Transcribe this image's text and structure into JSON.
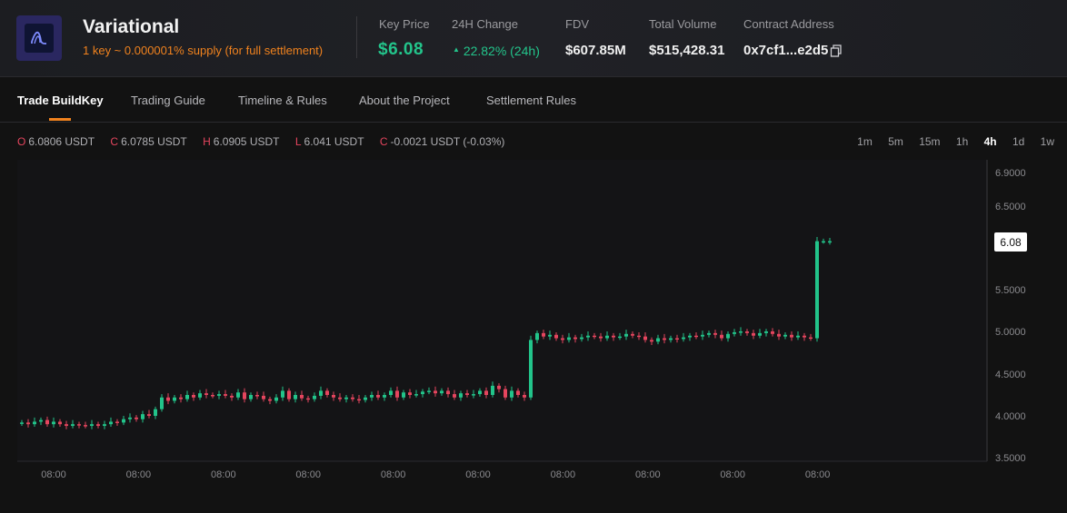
{
  "header": {
    "title": "Variational",
    "subtitle": "1 key ~ 0.000001% supply (for full settlement)",
    "stats": {
      "key_price_label": "Key Price",
      "key_price_value": "$6.08",
      "change_label": "24H Change",
      "change_value": "22.82% (24h)",
      "fdv_label": "FDV",
      "fdv_value": "$607.85M",
      "volume_label": "Total Volume",
      "volume_value": "$515,428.31",
      "contract_label": "Contract Address",
      "contract_value": "0x7cf1...e2d5"
    }
  },
  "tabs": [
    {
      "label": "Trade BuildKey",
      "active": true
    },
    {
      "label": "Trading Guide"
    },
    {
      "label": "Timeline & Rules"
    },
    {
      "label": "About the Project"
    },
    {
      "label": "Settlement Rules"
    }
  ],
  "ohlc": {
    "o_label": "O",
    "o_value": "6.0806 USDT",
    "c_label": "C",
    "c_value": "6.0785 USDT",
    "h_label": "H",
    "h_value": "6.0905 USDT",
    "l_label": "L",
    "l_value": "6.041 USDT",
    "chg_label": "C",
    "chg_value": "-0.0021 USDT (-0.03%)"
  },
  "intervals": [
    "1m",
    "5m",
    "15m",
    "1h",
    "4h",
    "1d",
    "1w"
  ],
  "selected_interval": "4h",
  "chart_data": {
    "type": "candlestick",
    "y_ticks": [
      "6.9000",
      "6.5000",
      "5.5000",
      "5.0000",
      "4.5000",
      "4.0000",
      "3.5000"
    ],
    "x_ticks": [
      "08:00",
      "08:00",
      "08:00",
      "08:00",
      "08:00",
      "08:00",
      "08:00",
      "08:00",
      "08:00",
      "08:00"
    ],
    "ylim": [
      3.5,
      6.9
    ],
    "last_price_label": "6.08",
    "colors": {
      "up": "#22c48a",
      "down": "#e5455e"
    },
    "close": [
      3.92,
      3.9,
      3.93,
      3.95,
      3.9,
      3.93,
      3.9,
      3.88,
      3.9,
      3.89,
      3.88,
      3.9,
      3.88,
      3.9,
      3.93,
      3.92,
      3.96,
      3.98,
      3.96,
      4.02,
      4.0,
      4.08,
      4.22,
      4.18,
      4.22,
      4.2,
      4.25,
      4.22,
      4.27,
      4.25,
      4.24,
      4.26,
      4.24,
      4.22,
      4.28,
      4.2,
      4.25,
      4.24,
      4.2,
      4.18,
      4.22,
      4.3,
      4.2,
      4.25,
      4.21,
      4.2,
      4.24,
      4.3,
      4.25,
      4.22,
      4.2,
      4.22,
      4.2,
      4.19,
      4.22,
      4.25,
      4.22,
      4.25,
      4.3,
      4.22,
      4.28,
      4.25,
      4.26,
      4.29,
      4.3,
      4.27,
      4.3,
      4.26,
      4.22,
      4.27,
      4.25,
      4.26,
      4.3,
      4.25,
      4.36,
      4.32,
      4.22,
      4.3,
      4.25,
      4.22,
      4.9,
      4.98,
      4.94,
      4.96,
      4.92,
      4.9,
      4.93,
      4.91,
      4.93,
      4.95,
      4.94,
      4.92,
      4.95,
      4.93,
      4.94,
      4.97,
      4.95,
      4.94,
      4.9,
      4.88,
      4.92,
      4.9,
      4.92,
      4.91,
      4.93,
      4.95,
      4.94,
      4.96,
      4.98,
      4.96,
      4.92,
      4.97,
      4.99,
      5.0,
      4.98,
      4.95,
      4.98,
      5.0,
      4.97,
      4.94,
      4.96,
      4.93,
      4.95,
      4.93,
      4.92,
      6.08,
      6.08,
      6.08
    ]
  }
}
